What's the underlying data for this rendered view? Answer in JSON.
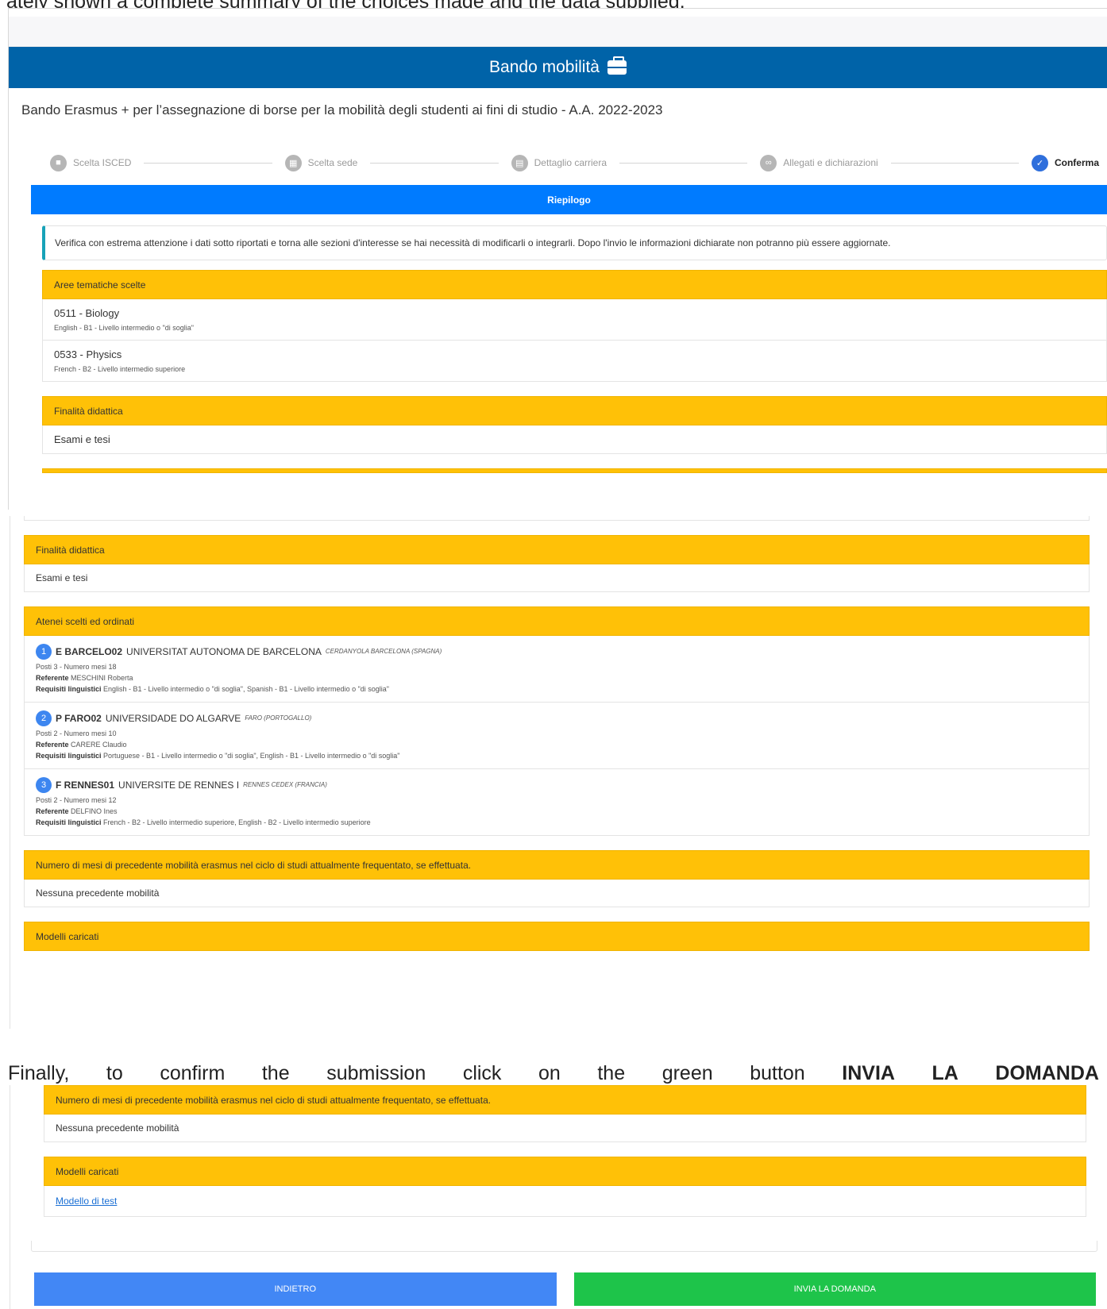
{
  "doc": {
    "intro_text": "ately shown a complete summary of the choices made and the data supplied.",
    "final_words": [
      "Finally,",
      "to",
      "confirm",
      "the",
      "submission",
      "click",
      "on",
      "the",
      "green",
      "button"
    ],
    "final_bold": [
      "INVIA",
      "LA",
      "DOMANDA"
    ]
  },
  "shot1": {
    "header_title": "Bando mobilità",
    "header_icon": "briefcase-icon",
    "page_title": "Bando Erasmus + per l’assegnazione di borse per la mobilità degli studenti ai fini di studio - A.A. 2022-2023",
    "steps": [
      {
        "label": "Scelta ISCED",
        "icon": "briefcase-icon"
      },
      {
        "label": "Scelta sede",
        "icon": "building-icon"
      },
      {
        "label": "Dettaglio carriera",
        "icon": "book-icon"
      },
      {
        "label": "Allegati e dichiarazioni",
        "icon": "paperclip-icon"
      },
      {
        "label": "Conferma",
        "icon": "check-icon"
      }
    ],
    "card_title": "Riepilogo",
    "notice": "Verifica con estrema attenzione i dati sotto riportati e torna alle sezioni d'interesse se hai necessità di modificarli o integrarli. Dopo l'invio le informazioni dichiarate non potranno più essere aggiornate.",
    "aree_title": "Aree tematiche scelte",
    "aree": [
      {
        "main": "0511 - Biology",
        "sub": "English - B1 - Livello intermedio o \"di soglia\""
      },
      {
        "main": "0533 - Physics",
        "sub": "French - B2 - Livello intermedio superiore"
      }
    ],
    "finalita_title": "Finalità didattica",
    "finalita_value": "Esami e tesi"
  },
  "shot2": {
    "finalita_title": "Finalità didattica",
    "finalita_value": "Esami e tesi",
    "atenei_title": "Atenei scelti ed ordinati",
    "labels": {
      "referente": "Referente",
      "requisiti": "Requisiti linguistici"
    },
    "atenei": [
      {
        "num": "1",
        "code": "E BARCELO02",
        "name": "UNIVERSITAT AUTONOMA DE BARCELONA",
        "city": "CERDANYOLA BARCELONA (SPAGNA)",
        "posti": "Posti 3 - Numero mesi 18",
        "referente": "MESCHINI Roberta",
        "requisiti": "English - B1 - Livello intermedio o \"di soglia\", Spanish - B1 - Livello intermedio o \"di soglia\""
      },
      {
        "num": "2",
        "code": "P FARO02",
        "name": "UNIVERSIDADE DO ALGARVE",
        "city": "FARO (PORTOGALLO)",
        "posti": "Posti 2 - Numero mesi 10",
        "referente": "CARERE Claudio",
        "requisiti": "Portuguese - B1 - Livello intermedio o \"di soglia\", English - B1 - Livello intermedio o \"di soglia\""
      },
      {
        "num": "3",
        "code": "F RENNES01",
        "name": "UNIVERSITE DE RENNES I",
        "city": "RENNES CEDEX (FRANCIA)",
        "posti": "Posti 2 - Numero mesi 12",
        "referente": "DELFINO Ines",
        "requisiti": "French - B2 - Livello intermedio superiore, English - B2 - Livello intermedio superiore"
      }
    ],
    "mesi_title": "Numero di mesi di precedente mobilità erasmus nel ciclo di studi attualmente frequentato, se effettuata.",
    "mesi_value": "Nessuna precedente mobilità",
    "modelli_title": "Modelli caricati"
  },
  "shot3": {
    "mesi_title": "Numero di mesi di precedente mobilità erasmus nel ciclo di studi attualmente frequentato, se effettuata.",
    "mesi_value": "Nessuna precedente mobilità",
    "modelli_title": "Modelli caricati",
    "modello_link": "Modello di test",
    "back_button": "INDIETRO",
    "send_button": "INVIA LA DOMANDA"
  },
  "colors": {
    "header": "#0063a8",
    "card_head": "#007bff",
    "section_head": "#ffc107",
    "back_button": "#4287f5",
    "send_button": "#1ec44a"
  }
}
